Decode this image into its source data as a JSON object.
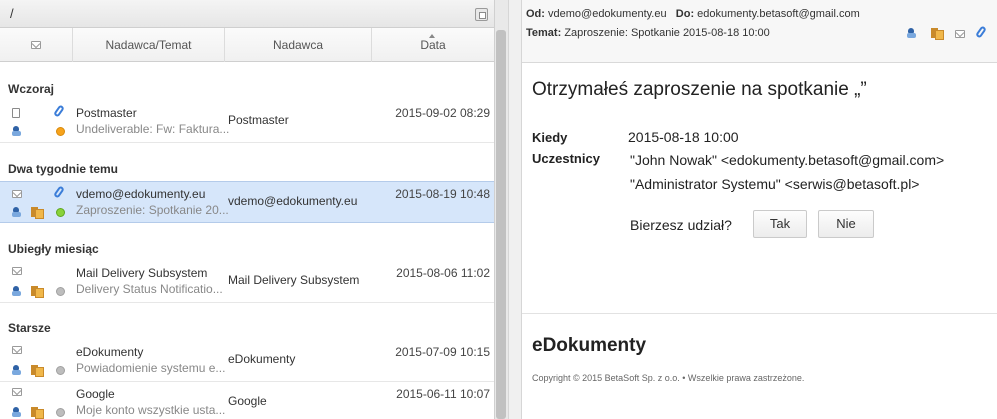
{
  "folder": {
    "path": "/"
  },
  "columns": {
    "subject": "Nadawca/Temat",
    "sender": "Nadawca",
    "date": "Data"
  },
  "groups": [
    "Wczoraj",
    "Dwa tygodnie temu",
    "Ubiegły miesiąc",
    "Starsze"
  ],
  "messages": [
    {
      "from": "Postmaster",
      "subject": "Undeliverable: Fw: Faktura...",
      "sender": "Postmaster",
      "date": "2015-09-02 08:29"
    },
    {
      "from": "vdemo@edokumenty.eu",
      "subject": "Zaproszenie: Spotkanie 20...",
      "sender": "vdemo@edokumenty.eu",
      "date": "2015-08-19 10:48"
    },
    {
      "from": "Mail Delivery Subsystem",
      "subject": "Delivery Status Notificatio...",
      "sender": "Mail Delivery Subsystem",
      "date": "2015-08-06 11:02"
    },
    {
      "from": "eDokumenty",
      "subject": "Powiadomienie systemu e...",
      "sender": "eDokumenty",
      "date": "2015-07-09 10:15"
    },
    {
      "from": "Google",
      "subject": "Moje konto wszystkie usta...",
      "sender": "Google",
      "date": "2015-06-11 10:07"
    }
  ],
  "preview": {
    "from_label": "Od:",
    "from": "vdemo@edokumenty.eu",
    "to_label": "Do:",
    "to": "edokumenty.betasoft@gmail.com",
    "subject_label": "Temat:",
    "subject": "Zaproszenie: Spotkanie 2015-08-18 10:00",
    "title": "Otrzymałeś zaproszenie na spotkanie „”",
    "when_label": "Kiedy",
    "when": "2015-08-18 10:00",
    "participants_label": "Uczestnicy",
    "participants": [
      "\"John Nowak\" <edokumenty.betasoft@gmail.com>",
      "\"Administrator Systemu\" <serwis@betasoft.pl>"
    ],
    "question": "Bierzesz udział?",
    "yes": "Tak",
    "no": "Nie",
    "brand": "eDokumenty",
    "copyright": "Copyright © 2015 BetaSoft Sp. z o.o. • Wszelkie prawa zastrzeżone."
  },
  "colors": {
    "selected_row": "#d6e6fa",
    "accent": "#3b7dd8"
  }
}
